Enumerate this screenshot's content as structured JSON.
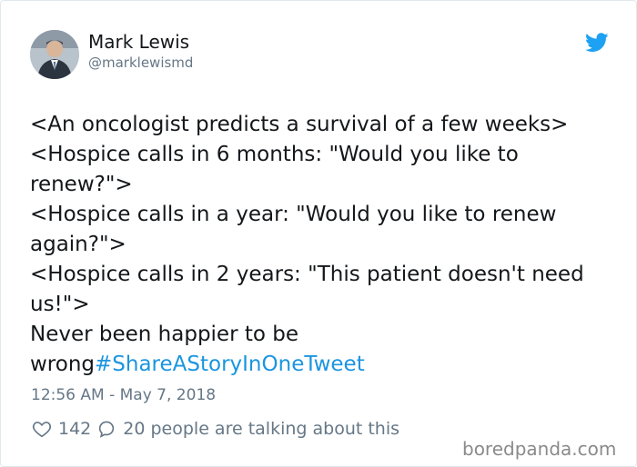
{
  "author": {
    "display_name": "Mark Lewis",
    "handle": "@marklewismd",
    "avatar_icon": "profile-photo"
  },
  "brand": {
    "icon": "twitter-bird-icon",
    "color": "#1da1f2"
  },
  "tweet": {
    "lines": [
      "<An oncologist predicts a survival of a few weeks>",
      "<Hospice calls in 6 months: \"Would you like to",
      "renew?\">",
      "<Hospice calls in a year: \"Would you like to renew",
      "again?\">",
      "<Hospice calls in 2 years: \"This patient doesn't need",
      "us!\">",
      "Never been happier to be"
    ],
    "last_line_text": "wrong",
    "hashtag": "#ShareAStoryInOneTweet",
    "hashtag_color": "#1b95e0"
  },
  "timestamp": "12:56 AM - May 7, 2018",
  "engagement": {
    "likes_icon": "heart-icon",
    "likes": "142",
    "replies_icon": "speech-bubble-icon",
    "talking_text": "20 people are talking about this"
  },
  "watermark": "boredpanda.com"
}
